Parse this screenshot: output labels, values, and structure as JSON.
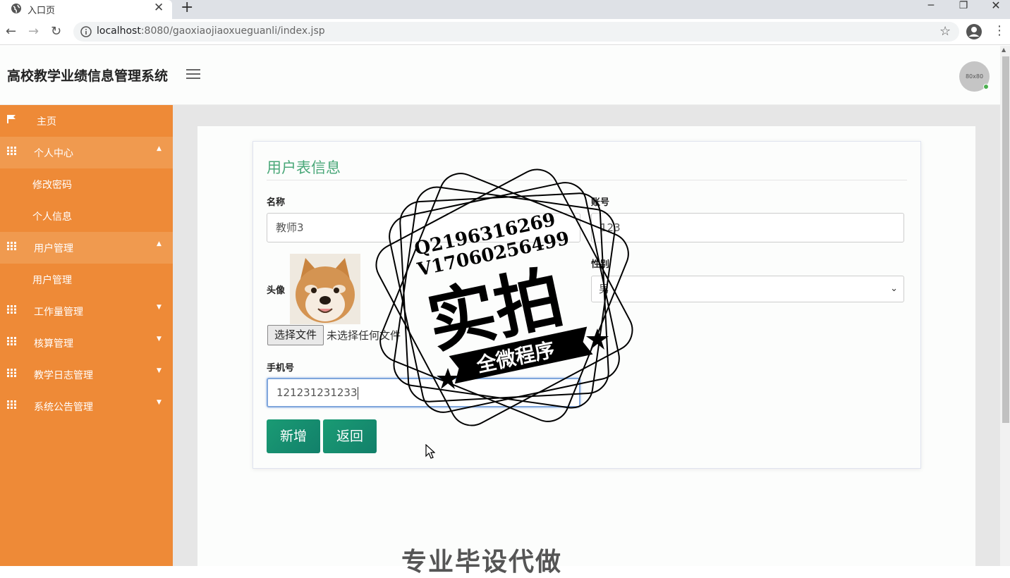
{
  "browser": {
    "tab_title": "入口页",
    "url_host": "localhost",
    "url_path": ":8080/gaoxiaojiaoxueguanli/index.jsp"
  },
  "header": {
    "title": "高校教学业绩信息管理系统",
    "avatar_text": "80x80"
  },
  "sidebar": {
    "items": [
      {
        "label": "主页"
      },
      {
        "label": "个人中心"
      },
      {
        "label": "修改密码"
      },
      {
        "label": "个人信息"
      },
      {
        "label": "用户管理"
      },
      {
        "label": "用户管理"
      },
      {
        "label": "工作量管理"
      },
      {
        "label": "核算管理"
      },
      {
        "label": "教学日志管理"
      },
      {
        "label": "系统公告管理"
      }
    ]
  },
  "form": {
    "title": "用户表信息",
    "name_label": "名称",
    "name_value": "教师3",
    "account_label": "账号",
    "account_value": "123",
    "avatar_label": "头像",
    "file_button": "选择文件",
    "file_status": "未选择任何文件",
    "gender_label": "性别",
    "gender_value": "男",
    "phone_label": "手机号",
    "phone_value": "121231231233",
    "add_button": "新增",
    "back_button": "返回"
  },
  "watermark": {
    "line1": "Q2196316269",
    "line2": "V17060256499",
    "main": "实拍",
    "ribbon": "全微程序",
    "bottom": "专业毕设代做"
  },
  "colors": {
    "sidebar": "#ee8a37",
    "title_green": "#4aa879",
    "button_green": "#1a9b74"
  }
}
